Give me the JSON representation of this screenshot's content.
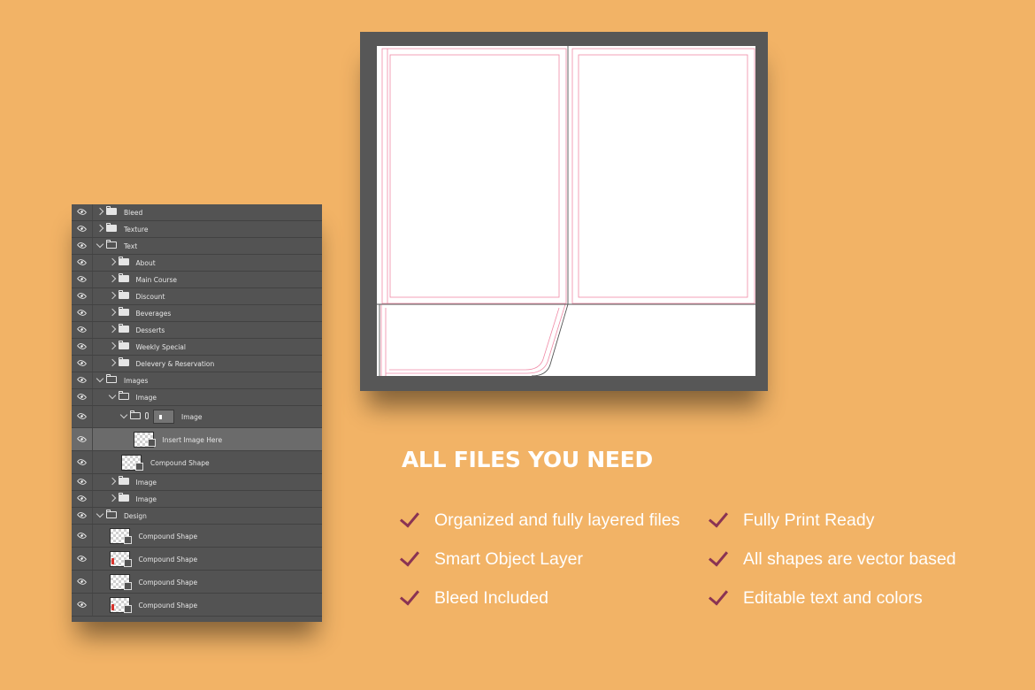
{
  "layers": [
    {
      "label": "Bleed",
      "indent": 0,
      "kind": "folder",
      "open": false
    },
    {
      "label": "Texture",
      "indent": 0,
      "kind": "folder",
      "open": false
    },
    {
      "label": "Text",
      "indent": 0,
      "kind": "folder",
      "open": true
    },
    {
      "label": "About",
      "indent": 1,
      "kind": "folder",
      "open": false
    },
    {
      "label": "Main Course",
      "indent": 1,
      "kind": "folder",
      "open": false
    },
    {
      "label": "Discount",
      "indent": 1,
      "kind": "folder",
      "open": false
    },
    {
      "label": "Beverages",
      "indent": 1,
      "kind": "folder",
      "open": false
    },
    {
      "label": "Desserts",
      "indent": 1,
      "kind": "folder",
      "open": false
    },
    {
      "label": "Weekly Special",
      "indent": 1,
      "kind": "folder",
      "open": false
    },
    {
      "label": "Delevery & Reservation",
      "indent": 1,
      "kind": "folder",
      "open": false
    },
    {
      "label": "Images",
      "indent": 0,
      "kind": "folder",
      "open": true
    },
    {
      "label": "Image",
      "indent": 1,
      "kind": "folder",
      "open": true
    },
    {
      "label": "Image",
      "indent": 2,
      "kind": "masked-folder",
      "open": true
    },
    {
      "label": "Insert Image Here",
      "indent": 3,
      "kind": "smart-object",
      "selected": true
    },
    {
      "label": "Compound Shape",
      "indent": 2,
      "kind": "shape"
    },
    {
      "label": "Image",
      "indent": 1,
      "kind": "folder",
      "open": false
    },
    {
      "label": "Image",
      "indent": 1,
      "kind": "folder",
      "open": false
    },
    {
      "label": "Design",
      "indent": 0,
      "kind": "folder",
      "open": true
    },
    {
      "label": "Compound Shape",
      "indent": 1,
      "kind": "shape"
    },
    {
      "label": "Compound Shape",
      "indent": 1,
      "kind": "shape",
      "red": true
    },
    {
      "label": "Compound Shape",
      "indent": 1,
      "kind": "shape"
    },
    {
      "label": "Compound Shape",
      "indent": 1,
      "kind": "shape",
      "red": true
    }
  ],
  "heading": "ALL FILES YOU NEED",
  "features": [
    "Organized and fully layered files",
    "Fully Print Ready",
    "Smart Object Layer",
    "All shapes are vector based",
    "Bleed Included",
    "Editable text and colors"
  ],
  "colors": {
    "background": "#f2b366",
    "panel": "#535353",
    "check": "#8a3353",
    "guide": "#f08aa6"
  }
}
